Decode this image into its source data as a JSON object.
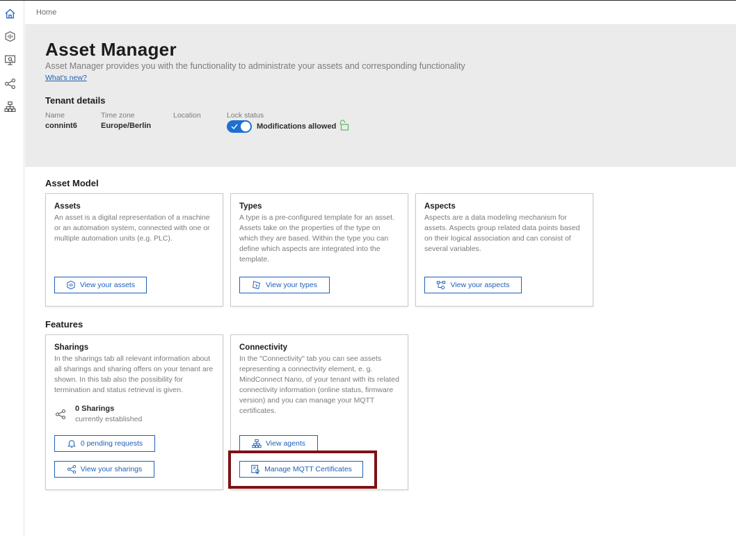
{
  "app": {
    "breadcrumb": "Home"
  },
  "sidebar": {
    "items": [
      {
        "icon": "home-icon"
      },
      {
        "icon": "asset-hexagon-icon"
      },
      {
        "icon": "monitor-search-icon"
      },
      {
        "icon": "share-nodes-icon"
      },
      {
        "icon": "hierarchy-icon"
      }
    ]
  },
  "header": {
    "title": "Asset Manager",
    "description": "Asset Manager provides you with the functionality to administrate your assets and corresponding functionality",
    "whats_new": "What's new?"
  },
  "tenant": {
    "heading": "Tenant details",
    "name_label": "Name",
    "name_value": "connint6",
    "timezone_label": "Time zone",
    "timezone_value": "Europe/Berlin",
    "location_label": "Location",
    "location_value": "",
    "lock_label": "Lock status",
    "lock_value": "Modifications allowed",
    "lock_enabled": true
  },
  "asset_model": {
    "heading": "Asset Model",
    "cards": [
      {
        "title": "Assets",
        "description": "An asset is a digital representation of a machine or an automation system, connected with one or multiple automation units (e.g. PLC).",
        "button": "View your assets",
        "button_icon": "asset-hexagon-icon"
      },
      {
        "title": "Types",
        "description": "A type is a pre-configured template for an asset. Assets take on the properties of the type on which they are based. Within the type you can define which aspects are integrated into the template.",
        "button": "View your types",
        "button_icon": "type-template-icon"
      },
      {
        "title": "Aspects",
        "description": "Aspects are a data modeling mechanism for assets. Aspects group related data points based on their logical association and can consist of several variables.",
        "button": "View your aspects",
        "button_icon": "aspect-nodes-icon"
      }
    ]
  },
  "features": {
    "heading": "Features",
    "sharings": {
      "title": "Sharings",
      "description": "In the sharings tab all relevant information about all sharings and sharing offers on your tenant are shown. In this tab also the possibility for termination and status retrieval is given.",
      "count": "0 Sharings",
      "count_sub": "currently established",
      "pending_button": "0 pending requests",
      "view_button": "View your sharings"
    },
    "connectivity": {
      "title": "Connectivity",
      "description": "In the \"Connectivity\" tab you can see assets representing a connectivity element, e. g. MindConnect Nano, of your tenant with its related connectivity information (online status, firmware version) and you can manage your MQTT certificates.",
      "agents_button": "View agents",
      "mqtt_button": "Manage MQTT Certificates"
    }
  },
  "colors": {
    "accent": "#1d5fb8",
    "toggle": "#1f6fd1",
    "highlight": "#7d1216",
    "hero_bg": "#ebebeb",
    "lock_icon": "#5cb85c"
  }
}
